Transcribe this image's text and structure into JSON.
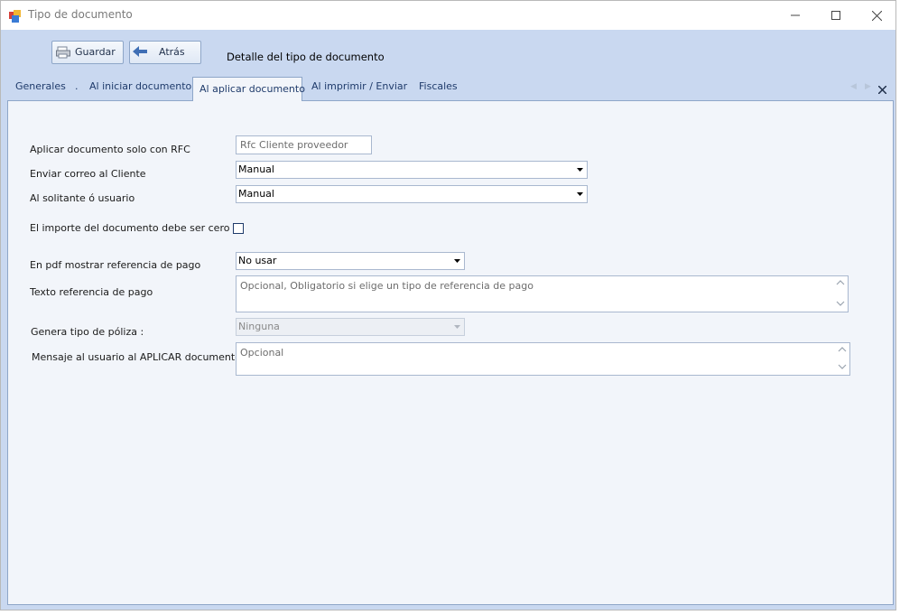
{
  "window": {
    "title": "Tipo de documento"
  },
  "toolbar": {
    "save_label": "Guardar",
    "back_label": "Atrás",
    "detail_title": "Detalle del tipo de documento"
  },
  "tabs": [
    {
      "label": "Generales"
    },
    {
      "label": "."
    },
    {
      "label": "Al iniciar documento"
    },
    {
      "label": "Al aplicar documento",
      "active": true
    },
    {
      "label": "Al imprimir / Enviar"
    },
    {
      "label": "Fiscales"
    }
  ],
  "form": {
    "rfc": {
      "label": "Aplicar documento solo con RFC",
      "placeholder": "Rfc Cliente proveedor"
    },
    "email_client": {
      "label": "Enviar correo al Cliente",
      "value": "Manual"
    },
    "requester": {
      "label": "Al solitante ó usuario",
      "value": "Manual"
    },
    "zero_amount": {
      "label": "El importe del documento debe ser cero",
      "checked": false
    },
    "pdf_ref": {
      "label": "En pdf mostrar referencia de pago",
      "value": "No usar"
    },
    "ref_text": {
      "label": "Texto referencia de pago",
      "placeholder": "Opcional, Obligatorio si elige un tipo de referencia de pago"
    },
    "policy_type": {
      "label": "Genera tipo de póliza :",
      "value": "Ninguna",
      "disabled": true
    },
    "apply_msg": {
      "label": "Mensaje al usuario al APLICAR documento",
      "placeholder": "Opcional"
    }
  },
  "colors": {
    "window_bg": "#c9d8f0",
    "panel_bg": "#f2f5fa",
    "tab_text": "#1f3b6b",
    "border": "#8ea6c8"
  }
}
